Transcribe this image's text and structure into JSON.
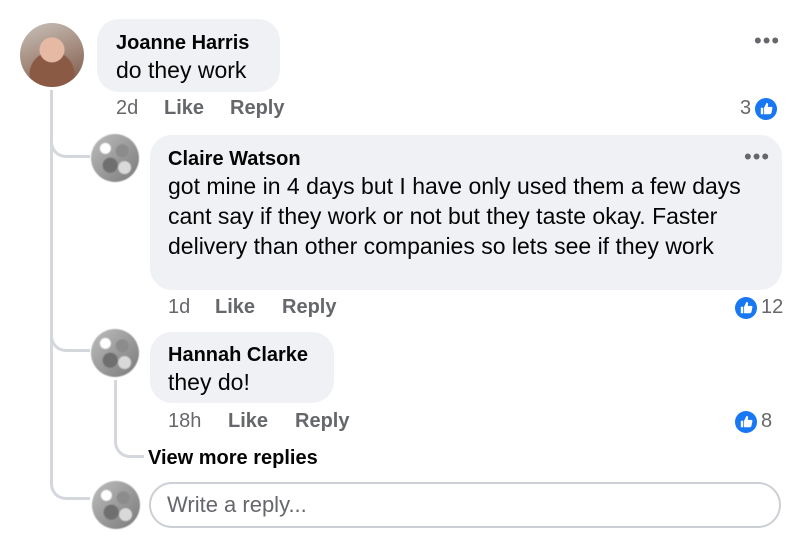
{
  "comment": {
    "author": "Joanne Harris",
    "text": "do they work",
    "time": "2d",
    "like_label": "Like",
    "reply_label": "Reply",
    "reaction_count": "3"
  },
  "replies": [
    {
      "author": "Claire Watson",
      "text": "got mine in 4 days but I have only used them a few days cant say if they work or not but they taste okay. Faster delivery than other companies so lets see if they work",
      "time": "1d",
      "like_label": "Like",
      "reply_label": "Reply",
      "reaction_count": "12"
    },
    {
      "author": "Hannah Clarke",
      "text": "they do!",
      "time": "18h",
      "like_label": "Like",
      "reply_label": "Reply",
      "reaction_count": "8"
    }
  ],
  "view_more_label": "View more replies",
  "reply_input": {
    "placeholder": "Write a reply..."
  },
  "icons": {
    "more": "more-options-icon",
    "like": "thumbs-up-icon"
  },
  "colors": {
    "like_blue": "#1877f2",
    "bubble_bg": "#eff1f4",
    "meta_grey": "#65676b"
  }
}
